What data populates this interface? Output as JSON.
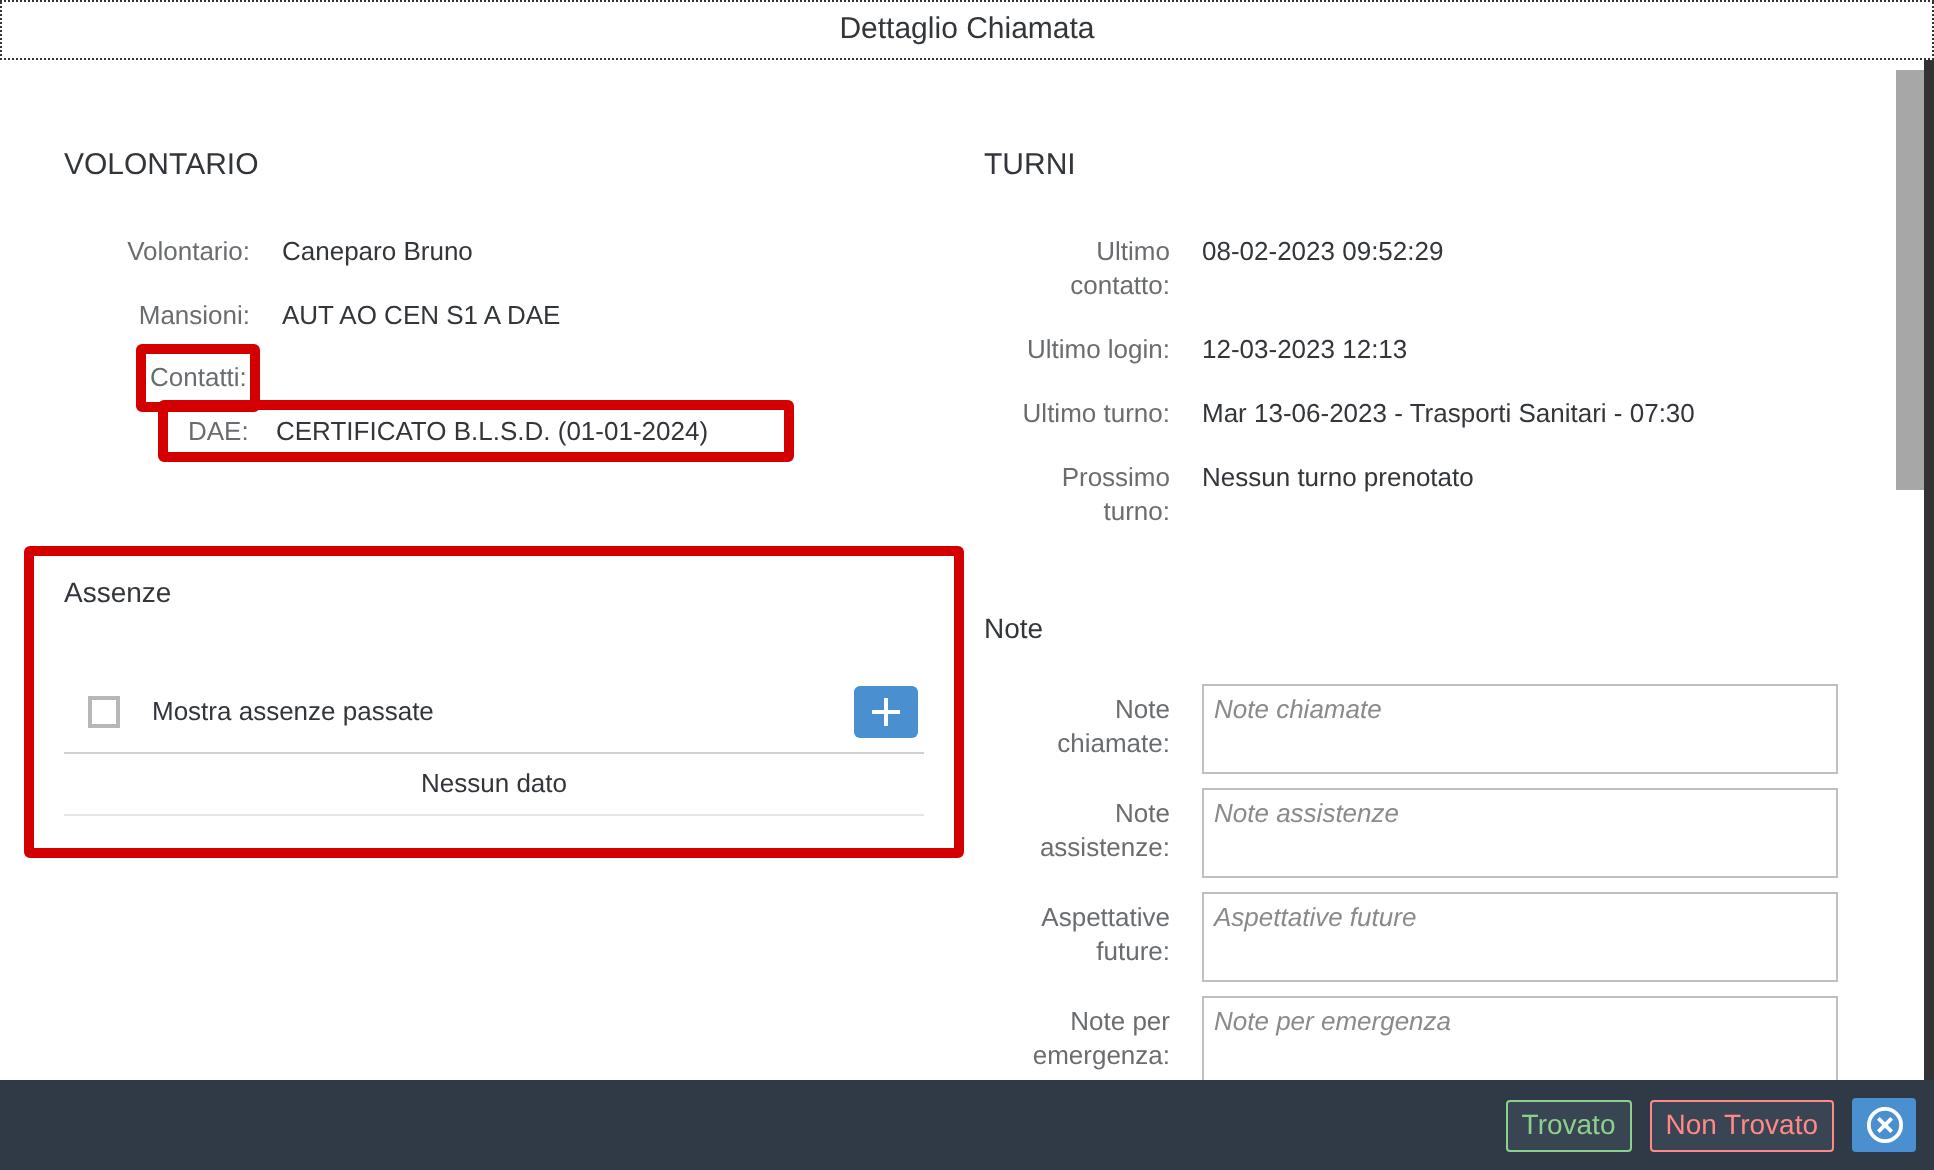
{
  "dialog": {
    "title": "Dettaglio Chiamata"
  },
  "volontario": {
    "heading": "VOLONTARIO",
    "fields": [
      {
        "label": "Volontario:",
        "value": "Caneparo Bruno"
      },
      {
        "label": "Mansioni:",
        "value": "AUT AO CEN S1 A DAE"
      }
    ],
    "contacts": {
      "label": "Contatti:",
      "highlighted": true,
      "items": [
        {
          "label": "DAE:",
          "value": "CERTIFICATO B.L.S.D. (01-01-2024)",
          "highlighted": true
        }
      ]
    }
  },
  "turni": {
    "heading": "TURNI",
    "fields": [
      {
        "label": "Ultimo contatto:",
        "value": "08-02-2023 09:52:29"
      },
      {
        "label": "Ultimo login:",
        "value": "12-03-2023 12:13"
      },
      {
        "label": "Ultimo turno:",
        "value": "Mar 13-06-2023 - Trasporti Sanitari - 07:30"
      },
      {
        "label": "Prossimo turno:",
        "value": "Nessun turno prenotato"
      }
    ]
  },
  "assenze": {
    "heading": "Assenze",
    "highlighted": true,
    "checkbox": {
      "label": "Mostra assenze passate",
      "checked": false
    },
    "empty_text": "Nessun dato"
  },
  "note": {
    "heading": "Note",
    "fields": [
      {
        "label": "Note chiamate:",
        "placeholder": "Note chiamate"
      },
      {
        "label": "Note assistenze:",
        "placeholder": "Note assistenze"
      },
      {
        "label": "Aspettative future:",
        "placeholder": "Aspettative future"
      },
      {
        "label": "Note per emergenza:",
        "placeholder": "Note per emergenza"
      }
    ]
  },
  "footer": {
    "buttons": [
      {
        "label": "Trovato",
        "kind": "success"
      },
      {
        "label": "Non Trovato",
        "kind": "danger"
      }
    ]
  }
}
